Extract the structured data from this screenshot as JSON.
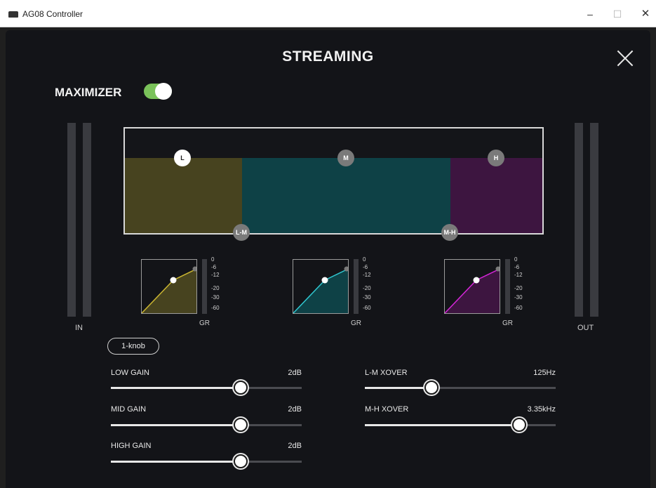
{
  "window": {
    "title": "AG08 Controller",
    "minimize": "–",
    "maximize": "☐",
    "close": "✕"
  },
  "page": {
    "title": "STREAMING"
  },
  "maximizer": {
    "label": "MAXIMIZER",
    "enabled": true
  },
  "meters": {
    "in_label": "IN",
    "out_label": "OUT"
  },
  "bands": {
    "handles": {
      "low": "L",
      "mid": "M",
      "high": "H"
    },
    "crossovers": {
      "lm": "L-M",
      "mh": "M-H"
    },
    "colors": {
      "low": "#47431f",
      "mid": "#0e4146",
      "high": "#3d1540",
      "low_line": "#c9b531",
      "mid_line": "#2fc6cf",
      "high_line": "#d526d8"
    }
  },
  "gr": {
    "label": "GR",
    "scale": [
      "0",
      "-6",
      "-12",
      "-20",
      "-30",
      "-60"
    ]
  },
  "one_knob": {
    "label": "1-knob"
  },
  "sliders": {
    "low_gain": {
      "label": "LOW GAIN",
      "value": "2dB",
      "position": 0.68
    },
    "mid_gain": {
      "label": "MID GAIN",
      "value": "2dB",
      "position": 0.68
    },
    "high_gain": {
      "label": "HIGH GAIN",
      "value": "2dB",
      "position": 0.68
    },
    "lm_xover": {
      "label": "L-M XOVER",
      "value": "125Hz",
      "position": 0.35
    },
    "mh_xover": {
      "label": "M-H XOVER",
      "value": "3.35kHz",
      "position": 0.81
    }
  }
}
